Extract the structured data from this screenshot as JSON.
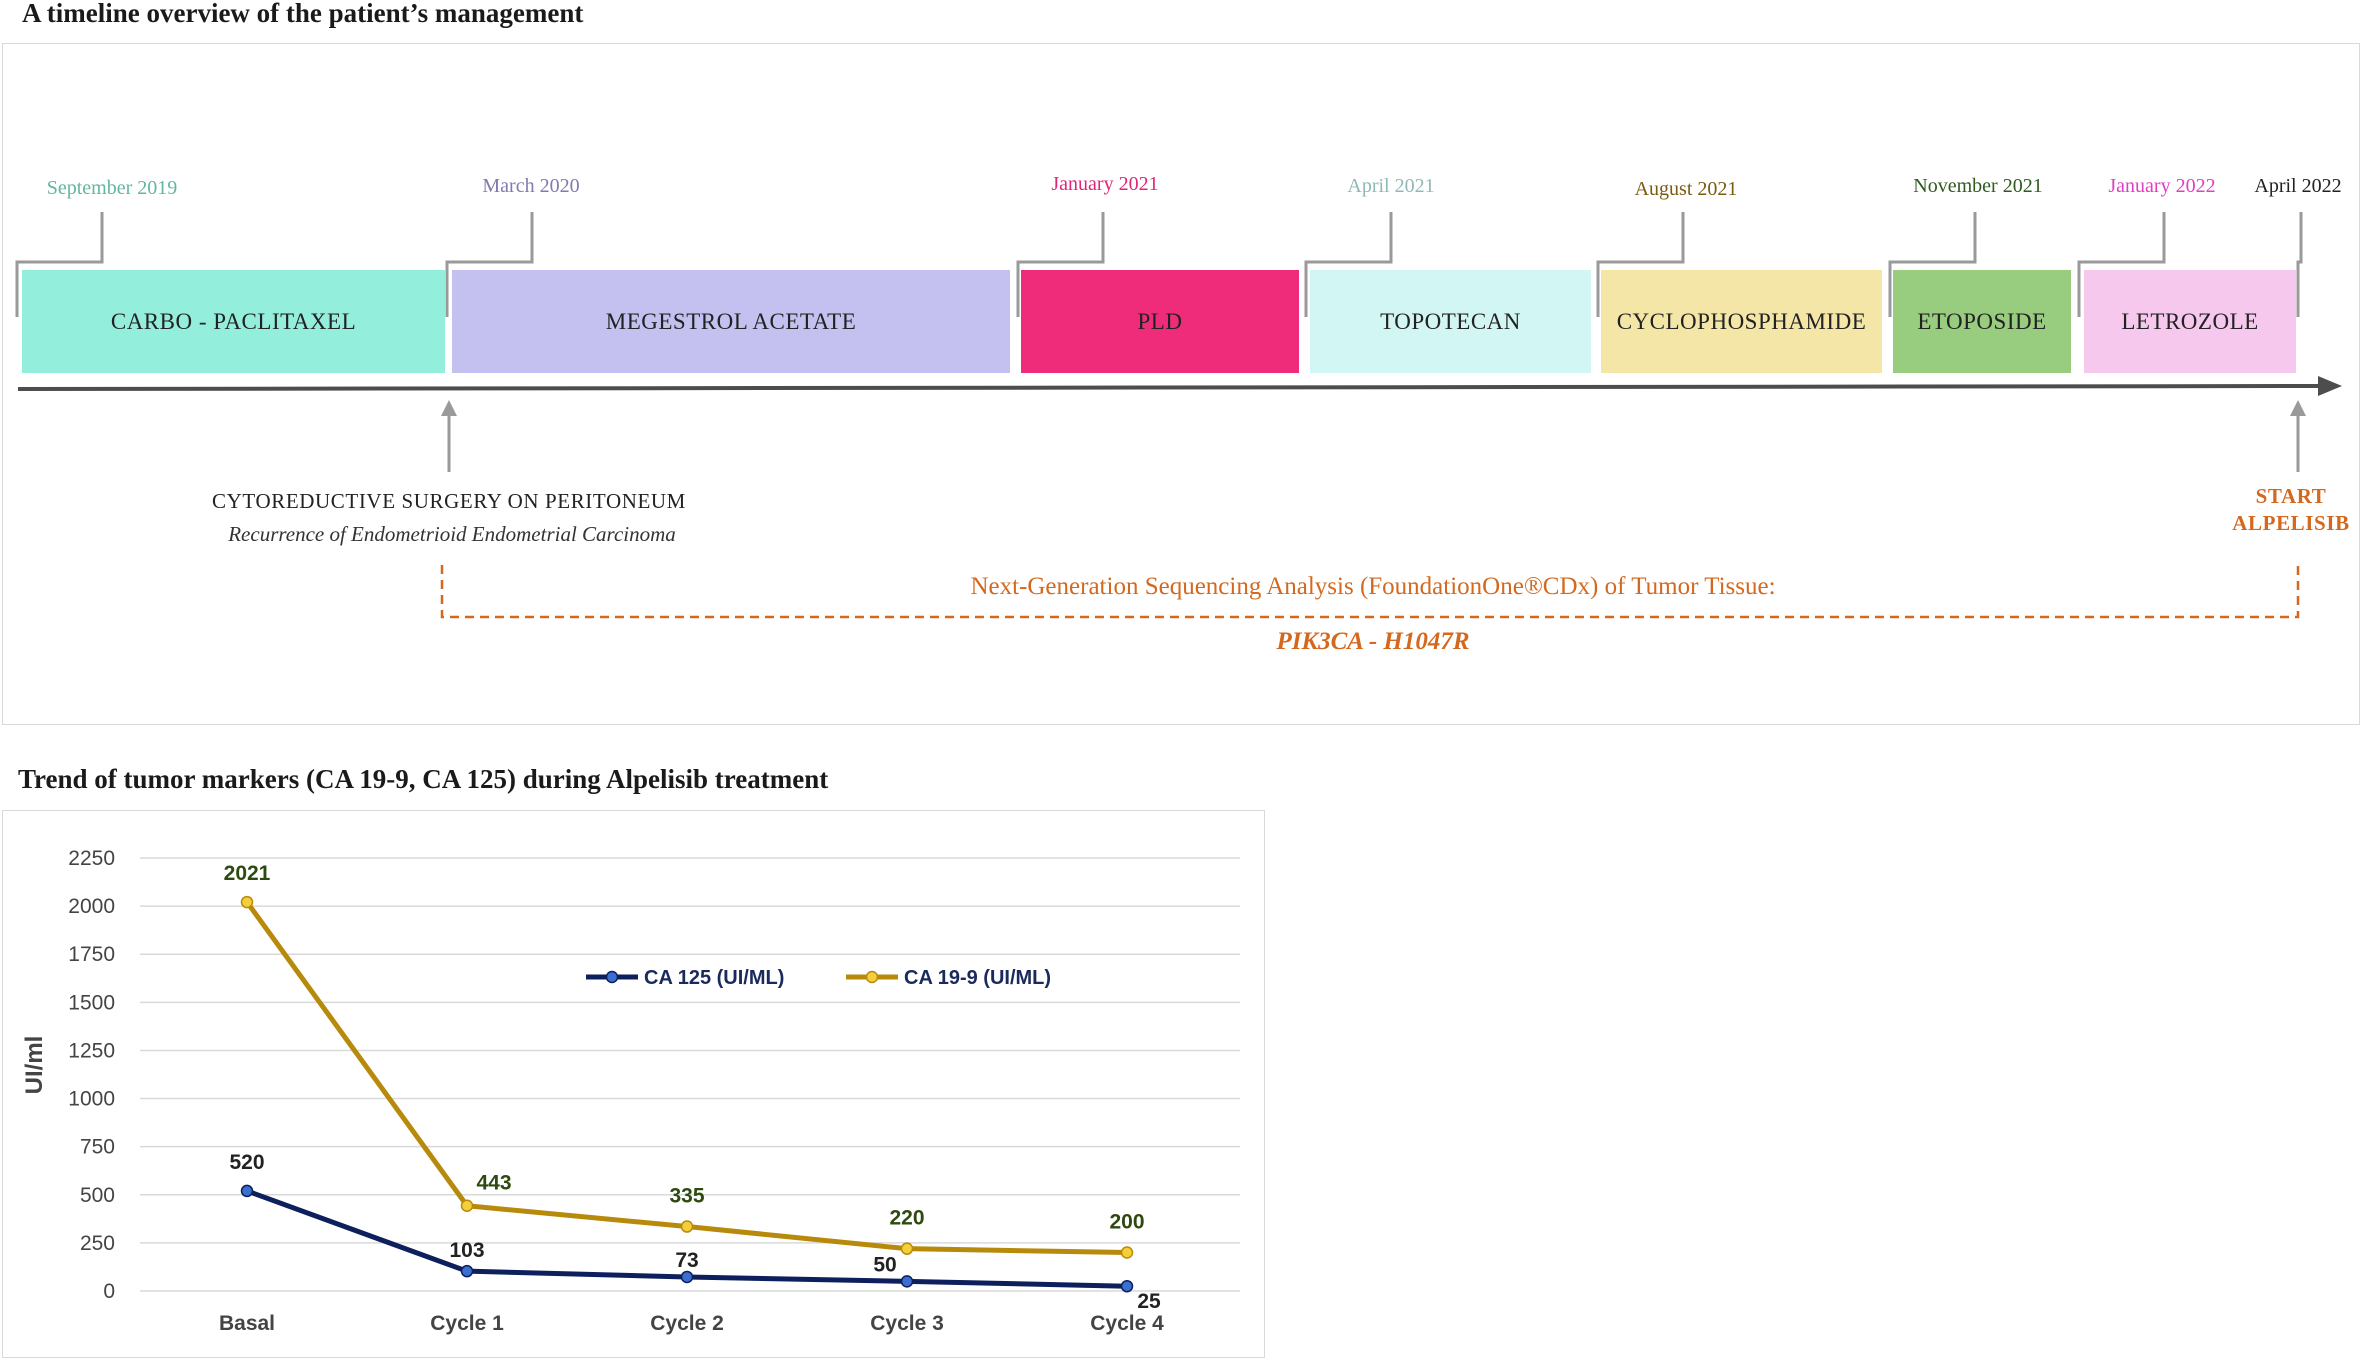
{
  "timeline": {
    "title": "A timeline overview of  the patient’s management",
    "dates": [
      {
        "label": "September 2019",
        "color": "#63b6a0"
      },
      {
        "label": "March 2020",
        "color": "#8478b0"
      },
      {
        "label": "January 2021",
        "color": "#e0247a"
      },
      {
        "label": "April 2021",
        "color": "#8fb8b6"
      },
      {
        "label": "August 2021",
        "color": "#7a5a10"
      },
      {
        "label": "November 2021",
        "color": "#2f5a1e"
      },
      {
        "label": "January 2022",
        "color": "#e03fc0"
      },
      {
        "label": "April 2022",
        "color": "#222222"
      }
    ],
    "treatments": [
      {
        "label": "CARBO - PACLITAXEL",
        "color": "#93eedc"
      },
      {
        "label": "MEGESTROL ACETATE",
        "color": "#c4c0f0"
      },
      {
        "label": "PLD",
        "color": "#ef2c7a"
      },
      {
        "label": "TOPOTECAN",
        "color": "#d2f6f3"
      },
      {
        "label": "CYCLOPHOSPHAMIDE",
        "color": "#f3e6a6"
      },
      {
        "label": "ETOPOSIDE",
        "color": "#98cc7e"
      },
      {
        "label": "LETROZOLE",
        "color": "#f6c8ee"
      }
    ],
    "event": {
      "main": "CYTOREDUCTIVE SURGERY ON PERITONEUM",
      "sub": "Recurrence of Endometrioid Endometrial Carcinoma"
    },
    "ngs": {
      "main": "Next-Generation Sequencing Analysis (FoundationOne®CDx) of Tumor Tissue:",
      "sub": "PIK3CA - H1047R"
    },
    "alpelisib": [
      "START",
      "ALPELISIB"
    ]
  },
  "chart_title": "Trend of tumor markers (CA 19-9, CA 125) during Alpelisib treatment",
  "chart_data": {
    "type": "line",
    "categories": [
      "Basal",
      "Cycle 1",
      "Cycle 2",
      "Cycle 3",
      "Cycle 4"
    ],
    "series": [
      {
        "name": "CA 125 (UI/ML)",
        "values": [
          520,
          103,
          73,
          50,
          25
        ],
        "color": "#0d1f5c",
        "marker_color": "#3a6fd0"
      },
      {
        "name": "CA 19-9 (UI/ML)",
        "values": [
          2021,
          443,
          335,
          220,
          200
        ],
        "color": "#b88a0c",
        "marker_color": "#f5cf3a"
      }
    ],
    "ylabel": "UI/ml",
    "xlabel": "",
    "ylim": [
      0,
      2250
    ],
    "yticks": [
      0,
      250,
      500,
      750,
      1000,
      1250,
      1500,
      1750,
      2000,
      2250
    ],
    "grid": true,
    "legend": "top-center",
    "label_colors": {
      "CA 125 (UI/ML)": "#222222",
      "CA 19-9 (UI/ML)": "#2f4a10"
    }
  }
}
